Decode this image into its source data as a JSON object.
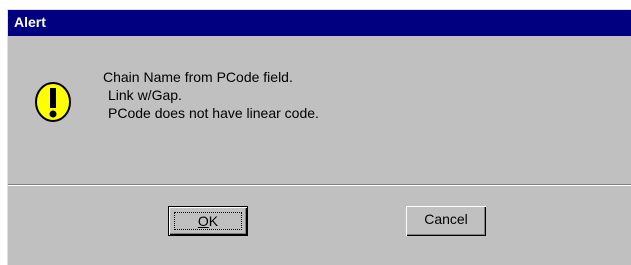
{
  "window": {
    "title": "Alert"
  },
  "message": {
    "lines": [
      "Chain Name from PCode field.",
      "Link w/Gap.",
      "PCode does not have linear code."
    ]
  },
  "icon": {
    "name": "warning-exclamation-icon",
    "fill_color": "#ffff00"
  },
  "buttons": {
    "ok_mnemonic": "O",
    "ok_rest": "K",
    "cancel_label": "Cancel"
  },
  "colors": {
    "titlebar": "#000080",
    "dialog_bg": "#c0c0c0"
  }
}
